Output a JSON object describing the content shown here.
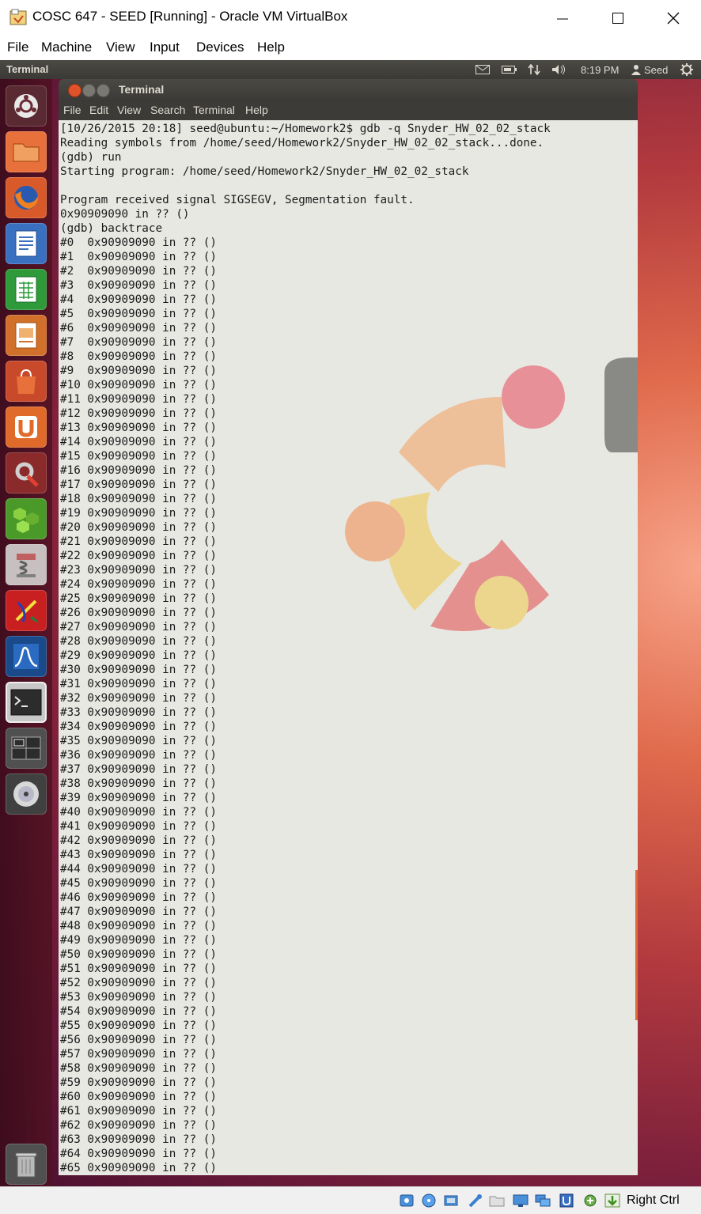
{
  "host_window": {
    "title": "COSC 647 - SEED [Running] - Oracle VM VirtualBox",
    "menu": [
      "File",
      "Machine",
      "View",
      "Input",
      "Devices",
      "Help"
    ],
    "host_key": "Right Ctrl"
  },
  "panel": {
    "app_title": "Terminal",
    "clock": "8:19 PM",
    "user": "Seed"
  },
  "terminal": {
    "title": "Terminal",
    "menu": [
      "File",
      "Edit",
      "View",
      "Search",
      "Terminal",
      "Help"
    ],
    "lines": [
      "[10/26/2015 20:18] seed@ubuntu:~/Homework2$ gdb -q Snyder_HW_02_02_stack",
      "Reading symbols from /home/seed/Homework2/Snyder_HW_02_02_stack...done.",
      "(gdb) run",
      "Starting program: /home/seed/Homework2/Snyder_HW_02_02_stack",
      "",
      "Program received signal SIGSEGV, Segmentation fault.",
      "0x90909090 in ?? ()",
      "(gdb) backtrace",
      "#0  0x90909090 in ?? ()",
      "#1  0x90909090 in ?? ()",
      "#2  0x90909090 in ?? ()",
      "#3  0x90909090 in ?? ()",
      "#4  0x90909090 in ?? ()",
      "#5  0x90909090 in ?? ()",
      "#6  0x90909090 in ?? ()",
      "#7  0x90909090 in ?? ()",
      "#8  0x90909090 in ?? ()",
      "#9  0x90909090 in ?? ()",
      "#10 0x90909090 in ?? ()",
      "#11 0x90909090 in ?? ()",
      "#12 0x90909090 in ?? ()",
      "#13 0x90909090 in ?? ()",
      "#14 0x90909090 in ?? ()",
      "#15 0x90909090 in ?? ()",
      "#16 0x90909090 in ?? ()",
      "#17 0x90909090 in ?? ()",
      "#18 0x90909090 in ?? ()",
      "#19 0x90909090 in ?? ()",
      "#20 0x90909090 in ?? ()",
      "#21 0x90909090 in ?? ()",
      "#22 0x90909090 in ?? ()",
      "#23 0x90909090 in ?? ()",
      "#24 0x90909090 in ?? ()",
      "#25 0x90909090 in ?? ()",
      "#26 0x90909090 in ?? ()",
      "#27 0x90909090 in ?? ()",
      "#28 0x90909090 in ?? ()",
      "#29 0x90909090 in ?? ()",
      "#30 0x90909090 in ?? ()",
      "#31 0x90909090 in ?? ()",
      "#32 0x90909090 in ?? ()",
      "#33 0x90909090 in ?? ()",
      "#34 0x90909090 in ?? ()",
      "#35 0x90909090 in ?? ()",
      "#36 0x90909090 in ?? ()",
      "#37 0x90909090 in ?? ()",
      "#38 0x90909090 in ?? ()",
      "#39 0x90909090 in ?? ()",
      "#40 0x90909090 in ?? ()",
      "#41 0x90909090 in ?? ()",
      "#42 0x90909090 in ?? ()",
      "#43 0x90909090 in ?? ()",
      "#44 0x90909090 in ?? ()",
      "#45 0x90909090 in ?? ()",
      "#46 0x90909090 in ?? ()",
      "#47 0x90909090 in ?? ()",
      "#48 0x90909090 in ?? ()",
      "#49 0x90909090 in ?? ()",
      "#50 0x90909090 in ?? ()",
      "#51 0x90909090 in ?? ()",
      "#52 0x90909090 in ?? ()",
      "#53 0x90909090 in ?? ()",
      "#54 0x90909090 in ?? ()",
      "#55 0x90909090 in ?? ()",
      "#56 0x90909090 in ?? ()",
      "#57 0x90909090 in ?? ()",
      "#58 0x90909090 in ?? ()",
      "#59 0x90909090 in ?? ()",
      "#60 0x90909090 in ?? ()",
      "#61 0x90909090 in ?? ()",
      "#62 0x90909090 in ?? ()",
      "#63 0x90909090 in ?? ()",
      "#64 0x90909090 in ?? ()",
      "#65 0x90909090 in ?? ()"
    ]
  },
  "launcher_icons": [
    "dash-home-icon",
    "files-icon",
    "firefox-icon",
    "writer-icon",
    "calc-icon",
    "impress-icon",
    "software-center-icon",
    "ubuntu-one-icon",
    "system-settings-icon",
    "green-app-icon",
    "archive-app-icon",
    "red-app-icon",
    "wireshark-icon",
    "terminal-icon",
    "workspace-switcher-icon",
    "disc-icon",
    "trash-icon"
  ],
  "colors": {
    "terminal_bg": "#e8e8e3",
    "panel_bg": "#3c3b37",
    "accent": "#e06a3c"
  }
}
